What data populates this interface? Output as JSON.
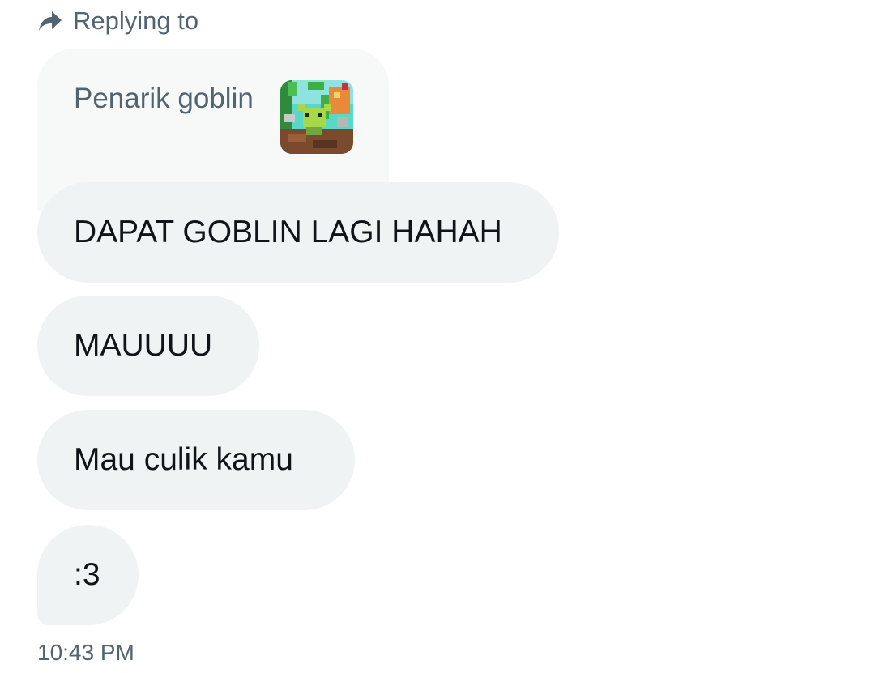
{
  "reply_header": {
    "icon": "reply-arrow-icon",
    "label": "Replying to"
  },
  "quoted_message": {
    "text": "Penarik goblin",
    "thumbnail": "goblin-game-thumbnail"
  },
  "messages": [
    {
      "text": "DAPAT GOBLIN LAGI HAHAH"
    },
    {
      "text": "MAUUUU"
    },
    {
      "text": "Mau culik kamu"
    },
    {
      "text": ":3"
    }
  ],
  "timestamp": "10:43 PM",
  "colors": {
    "bubble_bg": "#eff3f4",
    "quoted_bg": "#f7f9f9",
    "secondary_text": "#536471",
    "primary_text": "#0f1419"
  }
}
